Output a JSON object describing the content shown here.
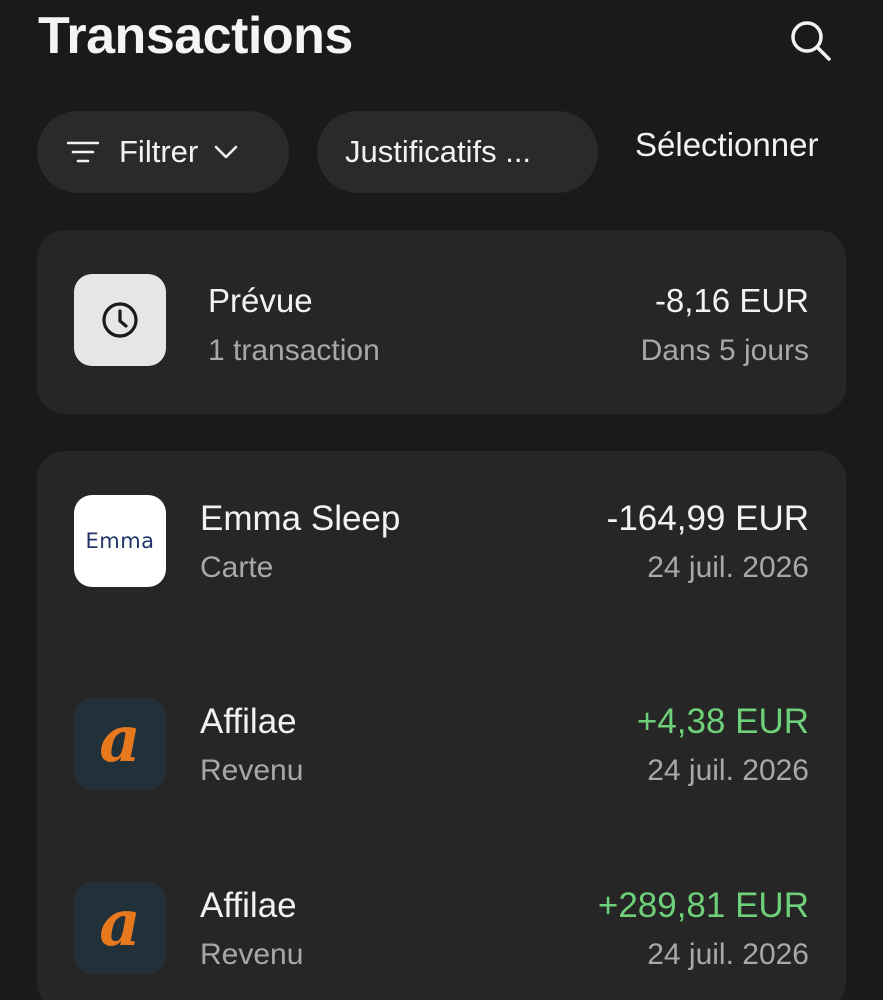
{
  "header": {
    "title": "Transactions"
  },
  "toolbar": {
    "filter_label": "Filtrer",
    "docs_label": "Justificatifs ...",
    "select_label": "Sélectionner"
  },
  "planned": {
    "label": "Prévue",
    "count": "1 transaction",
    "amount": "-8,16 EUR",
    "when": "Dans 5 jours"
  },
  "transactions": [
    {
      "merchant": "Emma Sleep",
      "logo_text": "Emma",
      "type": "Carte",
      "amount": "-164,99 EUR",
      "date": "24 juil. 2026"
    },
    {
      "merchant": "Affilae",
      "logo_text": "a",
      "type": "Revenu",
      "amount": "+4,38 EUR",
      "date": "24 juil. 2026"
    },
    {
      "merchant": "Affilae",
      "logo_text": "a",
      "type": "Revenu",
      "amount": "+289,81 EUR",
      "date": "24 juil. 2026"
    }
  ],
  "colors": {
    "background": "#1a1a1a",
    "card": "#262626",
    "positive": "#6fd07a",
    "affilae_orange": "#e8781e"
  }
}
